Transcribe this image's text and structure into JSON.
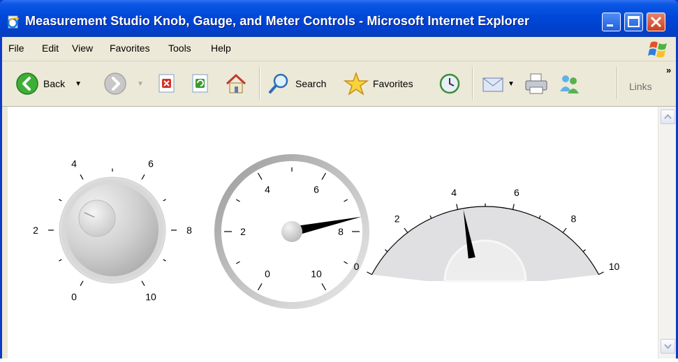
{
  "window": {
    "title": "Measurement Studio Knob, Gauge, and Meter Controls - Microsoft Internet Explorer",
    "buttons": [
      "minimize",
      "maximize",
      "close"
    ]
  },
  "menubar": {
    "items": [
      "File",
      "Edit",
      "View",
      "Favorites",
      "Tools",
      "Help"
    ]
  },
  "toolbar": {
    "back_label": "Back",
    "search_label": "Search",
    "favorites_label": "Favorites",
    "links_label": "Links",
    "chevron": "»"
  },
  "controls": {
    "knob": {
      "ticks": [
        "0",
        "2",
        "4",
        "6",
        "8",
        "10"
      ],
      "range": [
        0,
        10
      ],
      "value": 2.8
    },
    "gauge": {
      "ticks": [
        "0",
        "2",
        "4",
        "6",
        "8",
        "10"
      ],
      "range": [
        0,
        10
      ],
      "value": 7.6
    },
    "meter": {
      "ticks": [
        "0",
        "2",
        "4",
        "6",
        "8",
        "10"
      ],
      "range": [
        0,
        10
      ],
      "value": 4.2
    }
  },
  "colors": {
    "titlebar": "#0047d8",
    "chrome": "#ece9d8",
    "close_button": "#c6401e"
  }
}
